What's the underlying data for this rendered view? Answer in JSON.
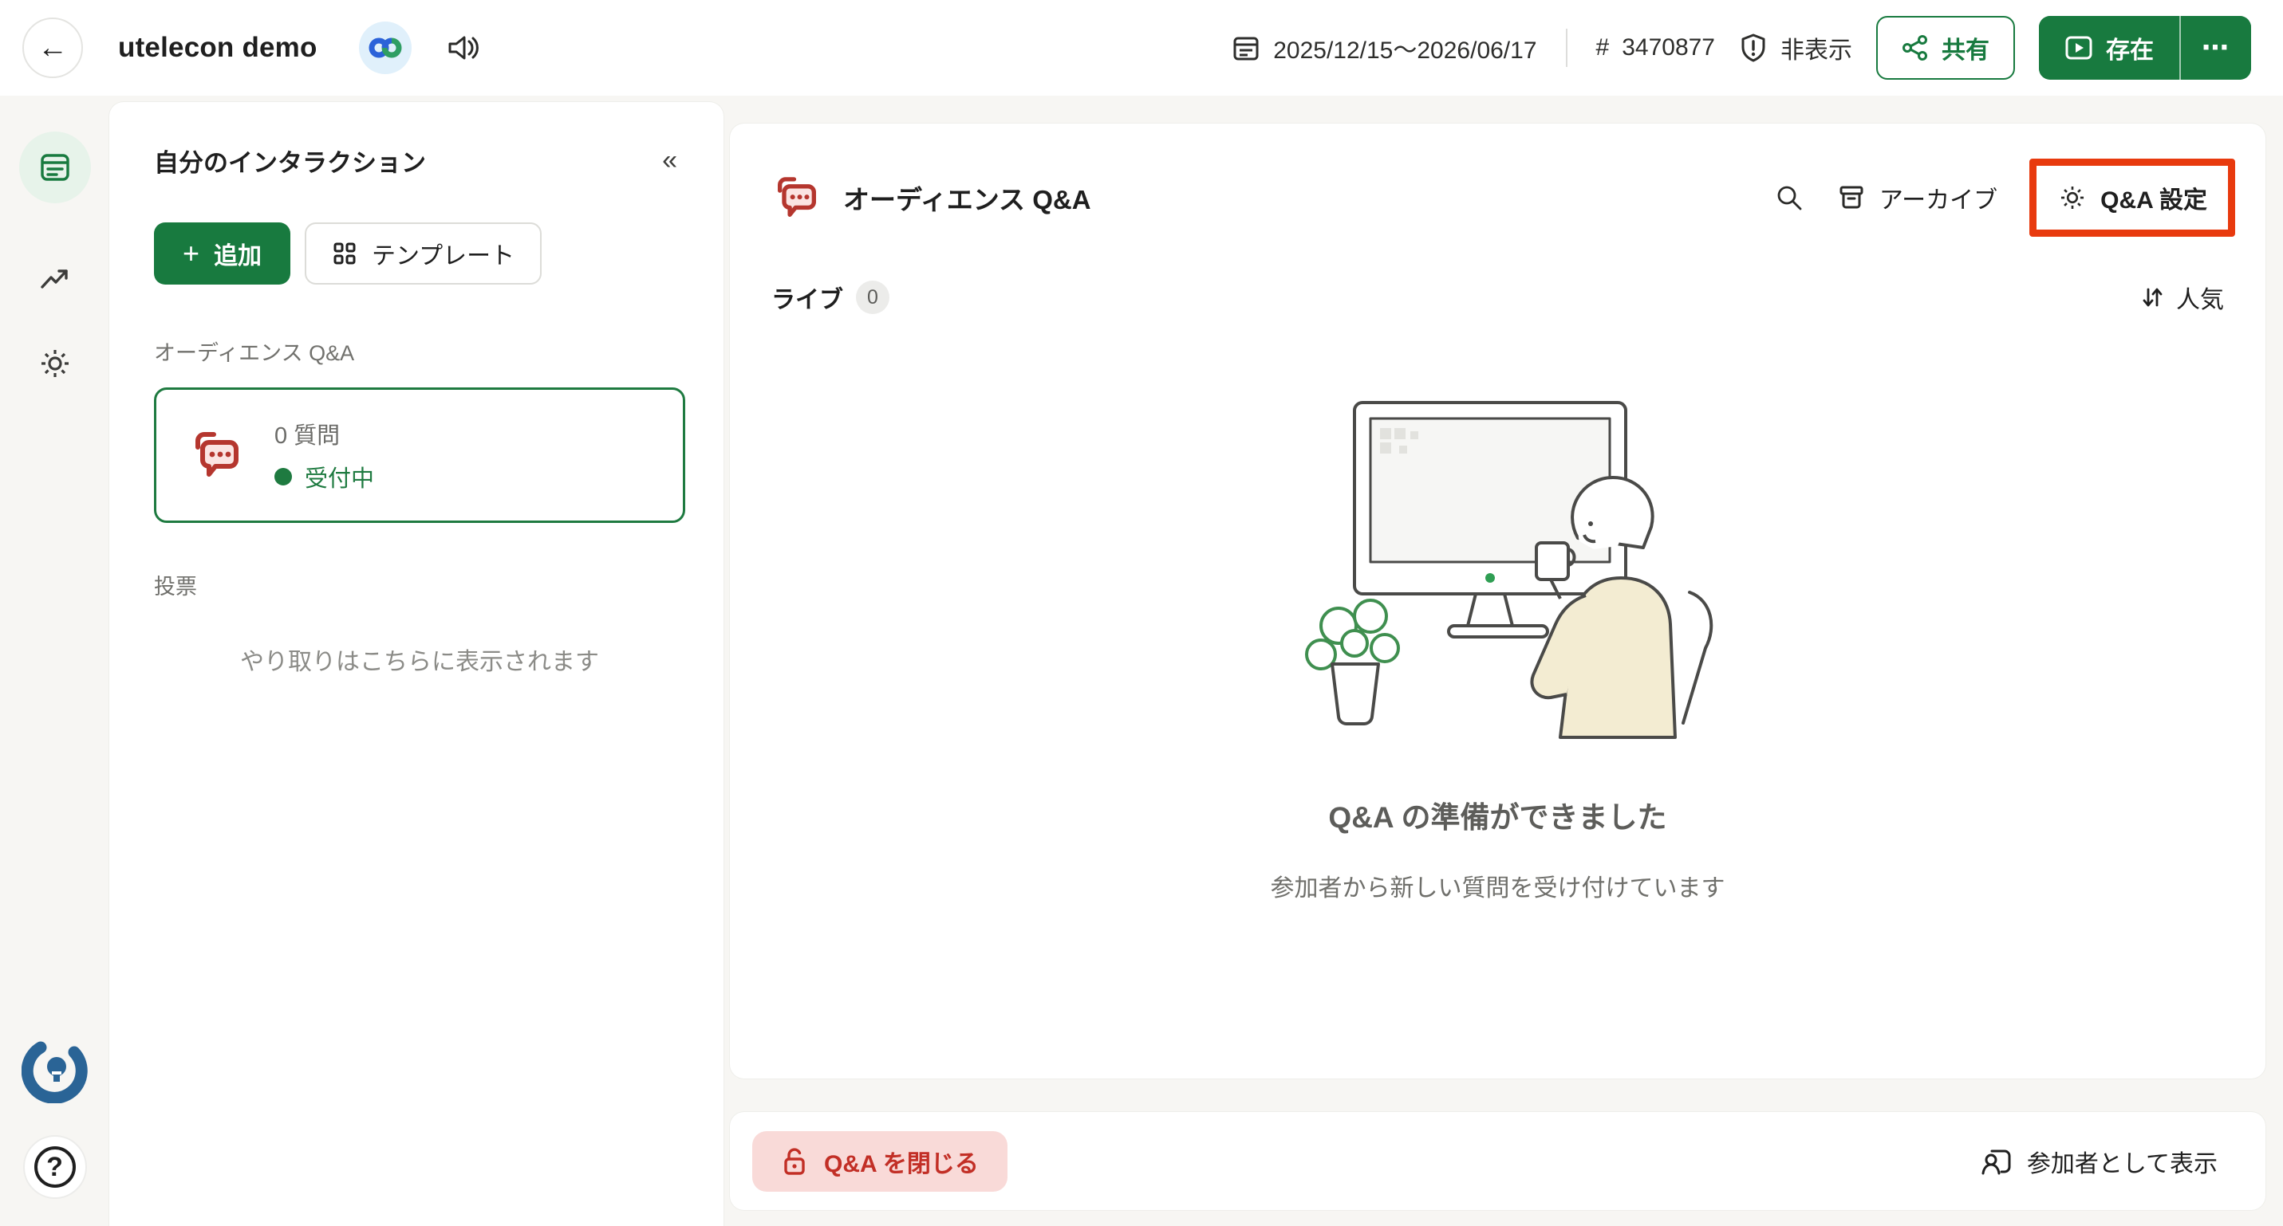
{
  "topbar": {
    "back_glyph": "←",
    "title": "utelecon demo",
    "date_range": "2025/12/15〜2026/06/17",
    "event_code_prefix": "#",
    "event_code": "3470877",
    "hidden_label": "非表示",
    "share_label": "共有",
    "present_label": "存在",
    "more_glyph": "⋯"
  },
  "sidebar": {
    "items": [
      {
        "label": "interactions",
        "active": true
      },
      {
        "label": "analytics",
        "active": false
      },
      {
        "label": "settings",
        "active": false
      }
    ],
    "help_glyph": "?"
  },
  "panel": {
    "title": "自分のインタラクション",
    "collapse_glyph": "«",
    "add_plus": "+",
    "add_label": "追加",
    "template_label": "テンプレート",
    "qa_section_label": "オーディエンス Q&A",
    "qa_card": {
      "count": "0 質問",
      "status": "受付中"
    },
    "polls_label": "投票",
    "hint": "やり取りはこちらに表示されます"
  },
  "main": {
    "title": "オーディエンス Q&A",
    "archive_label": "アーカイブ",
    "settings_label": "Q&A 設定",
    "live_tab": "ライブ",
    "live_count": "0",
    "sort_label": "人気",
    "empty_title": "Q&A の準備ができました",
    "empty_subtitle": "参加者から新しい質問を受け付けています"
  },
  "footer": {
    "close_label": "Q&A を閉じる",
    "participant_label": "参加者として表示"
  },
  "icons": [
    "arrow-left-icon",
    "webex-logo-icon",
    "speaker-icon",
    "calendar-icon",
    "shield-exclamation-icon",
    "share-nodes-icon",
    "presentation-play-icon",
    "ellipsis-icon",
    "interactions-icon",
    "trending-up-icon",
    "gear-icon",
    "slido-logo-icon",
    "question-mark-icon",
    "collapse-double-chevron-icon",
    "plus-icon",
    "template-grid-icon",
    "qa-chat-bubbles-icon",
    "status-dot-icon",
    "search-icon",
    "archive-box-icon",
    "sort-arrows-icon",
    "qa-ready-illustration",
    "unlock-icon",
    "participant-view-icon"
  ],
  "colors": {
    "accent_green": "#187a3f",
    "light_green_bg": "#e7f3ea",
    "qa_red": "#b5362e",
    "qa_pink": "#fbe4e2",
    "annotation_red": "#e83a0e",
    "close_button_bg": "#f9dad8",
    "close_button_text": "#c22f26",
    "slido_blue": "#2a6496",
    "webex_badge_bg": "#e0f0fb",
    "page_background": "#f7f6f3",
    "status_green": "#1e7a40"
  }
}
